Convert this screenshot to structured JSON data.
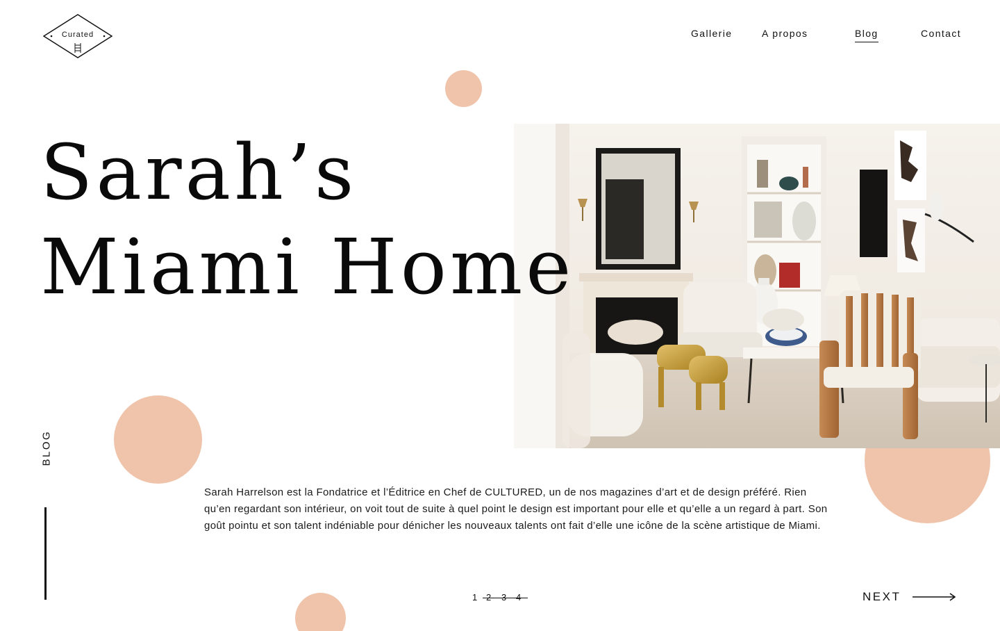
{
  "logo": {
    "text": "Curated",
    "icon": "ladder-mark-icon"
  },
  "nav": {
    "items": [
      {
        "label": "Gallerie",
        "active": false
      },
      {
        "label": "A propos",
        "active": false
      },
      {
        "label": "Blog",
        "active": true
      },
      {
        "label": "Contact",
        "active": false
      }
    ]
  },
  "hero": {
    "title_line1": "Sarah’s",
    "title_line2": "Miami Home",
    "photo": "living-room-photo"
  },
  "side_label": "BLOG",
  "body": {
    "text": "Sarah Harrelson est la Fondatrice et l’Éditrice en Chef de CULTURED, un de nos magazines d’art et de design préféré. Rien qu’en regardant son intérieur, on voit tout de suite à quel point le design est important pour elle et qu’elle a un regard à part. Son goût pointu et son talent indéniable pour dénicher les nouveaux talents ont fait d’elle une icône de la scène artistique de Miami."
  },
  "pagination": {
    "pages": [
      "1",
      "2",
      "3",
      "4"
    ],
    "current": "1"
  },
  "next": {
    "label": "NEXT",
    "icon": "arrow-right-icon"
  },
  "colors": {
    "accent": "#f0c4ab",
    "text": "#111111",
    "background": "#ffffff"
  }
}
